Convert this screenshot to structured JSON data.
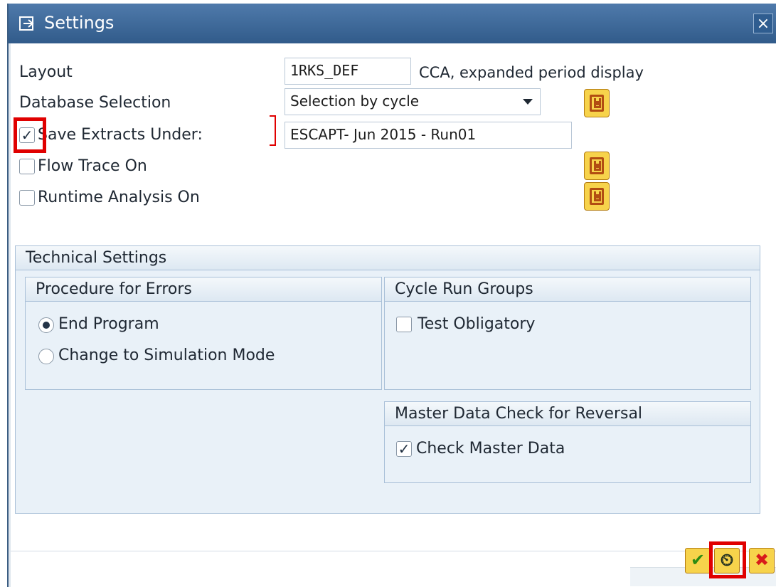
{
  "window": {
    "title": "Settings",
    "close_symbol": "×"
  },
  "form": {
    "layout_label": "Layout",
    "layout_value": "1RKS_DEF",
    "layout_description": "CCA, expanded period display",
    "database_selection_label": "Database Selection",
    "database_selection_value": "Selection by cycle",
    "save_extracts_label": "Save Extracts Under:",
    "save_extracts_checked": true,
    "save_extracts_value": "ESCAPT- Jun 2015 - Run01",
    "flow_trace_label": "Flow Trace On",
    "flow_trace_checked": false,
    "runtime_analysis_label": "Runtime Analysis On",
    "runtime_analysis_checked": false
  },
  "technical_settings": {
    "title": "Technical Settings",
    "procedure_for_errors": {
      "title": "Procedure for Errors",
      "options": [
        "End Program",
        "Change to Simulation Mode"
      ],
      "selected": "End Program"
    },
    "cycle_run_groups": {
      "title": "Cycle Run Groups",
      "test_obligatory_label": "Test Obligatory",
      "test_obligatory_checked": false
    },
    "master_data_check": {
      "title": "Master Data Check for Reversal",
      "check_master_data_label": "Check Master Data",
      "check_master_data_checked": true
    }
  },
  "footer": {
    "ok_symbol": "✔",
    "background_symbol": "⏲",
    "cancel_symbol": "✖"
  },
  "icons": [
    "settings-window-icon",
    "close-icon",
    "save-variant-icon",
    "dropdown-chevron-icon",
    "checkmark-icon",
    "clock-icon",
    "cancel-icon"
  ],
  "colors": {
    "title_bar": "#3f6a99",
    "highlight": "#e00000",
    "button_yellow": "#f7d34b",
    "panel": "#e9f1f8"
  }
}
